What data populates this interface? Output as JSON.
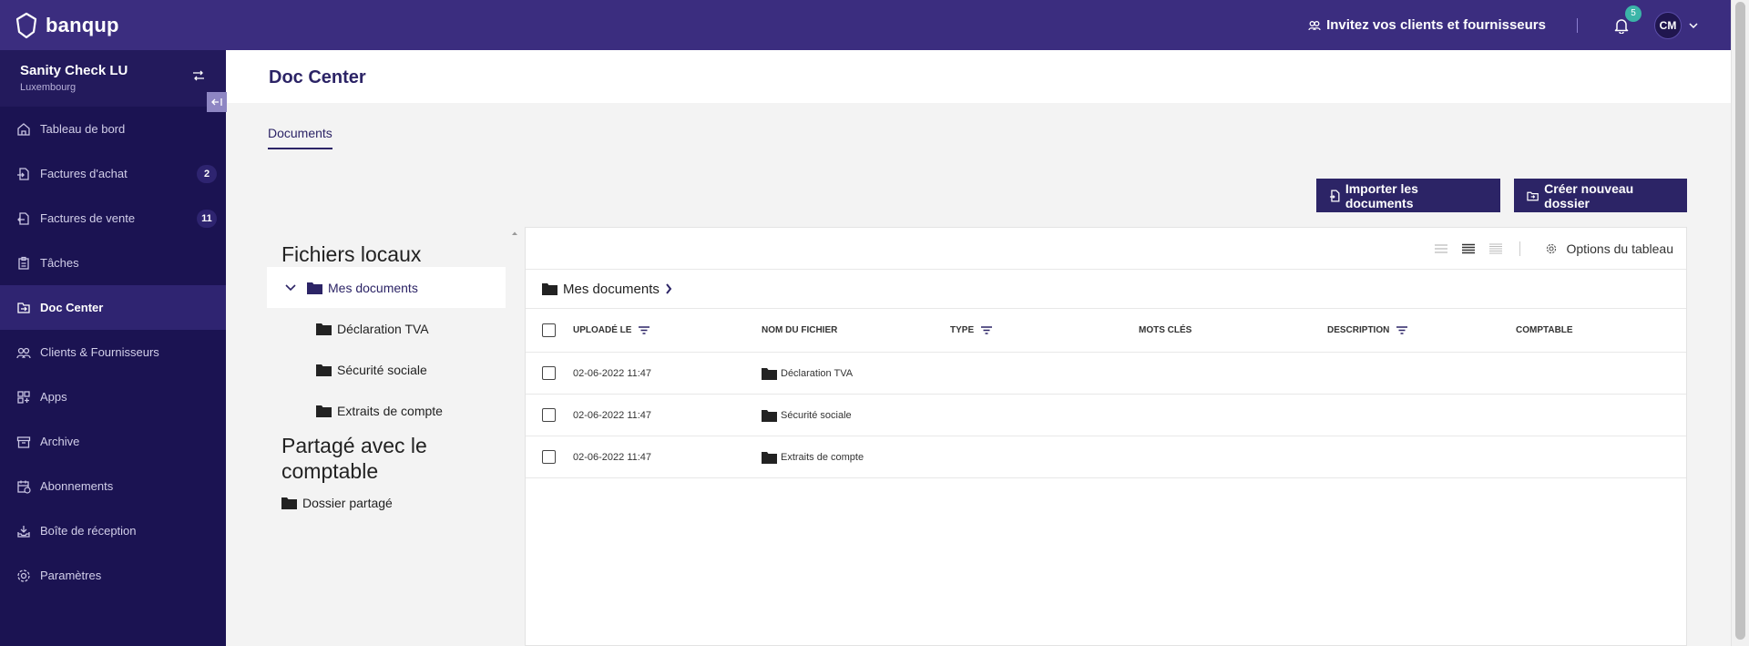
{
  "app": {
    "brand": "banqup"
  },
  "topbar": {
    "invite_label": "Invitez vos clients et fournisseurs",
    "notification_count": "5",
    "user_initials": "CM"
  },
  "company": {
    "name": "Sanity Check LU",
    "country": "Luxembourg"
  },
  "sidebar": {
    "items": [
      {
        "label": "Tableau de bord",
        "icon": "home-icon"
      },
      {
        "label": "Factures d'achat",
        "icon": "purchase-invoice-icon",
        "count": "2"
      },
      {
        "label": "Factures de vente",
        "icon": "sales-invoice-icon",
        "count": "11"
      },
      {
        "label": "Tâches",
        "icon": "clipboard-icon"
      },
      {
        "label": "Doc Center",
        "icon": "doc-center-icon",
        "active": true
      },
      {
        "label": "Clients & Fournisseurs",
        "icon": "people-icon"
      },
      {
        "label": "Apps",
        "icon": "apps-icon"
      },
      {
        "label": "Archive",
        "icon": "archive-icon"
      },
      {
        "label": "Abonnements",
        "icon": "subscription-icon"
      },
      {
        "label": "Boîte de réception",
        "icon": "inbox-icon"
      },
      {
        "label": "Paramètres",
        "icon": "settings-icon"
      }
    ]
  },
  "page": {
    "title": "Doc Center",
    "tab": "Documents"
  },
  "actions": {
    "import_label": "Importer les documents",
    "create_folder_label": "Créer nouveau dossier"
  },
  "tree": {
    "local_heading": "Fichiers locaux",
    "root": "Mes documents",
    "children": [
      "Déclaration TVA",
      "Sécurité sociale",
      "Extraits de compte"
    ],
    "shared_heading": "Partagé avec le comptable",
    "shared_folder": "Dossier partagé"
  },
  "table": {
    "options_label": "Options du tableau",
    "breadcrumb": "Mes documents",
    "columns": [
      "UPLOADÉ LE",
      "NOM DU FICHIER",
      "TYPE",
      "MOTS CLÉS",
      "DESCRIPTION",
      "COMPTABLE"
    ],
    "rows": [
      {
        "date": "02-06-2022 11:47",
        "name": "Déclaration TVA"
      },
      {
        "date": "02-06-2022 11:47",
        "name": "Sécurité sociale"
      },
      {
        "date": "02-06-2022 11:47",
        "name": "Extraits de compte"
      }
    ]
  },
  "colors": {
    "brand": "#3b2d7f",
    "sidebar": "#1b1352",
    "primary_button": "#2c2466",
    "badge": "#3bb5a8"
  }
}
